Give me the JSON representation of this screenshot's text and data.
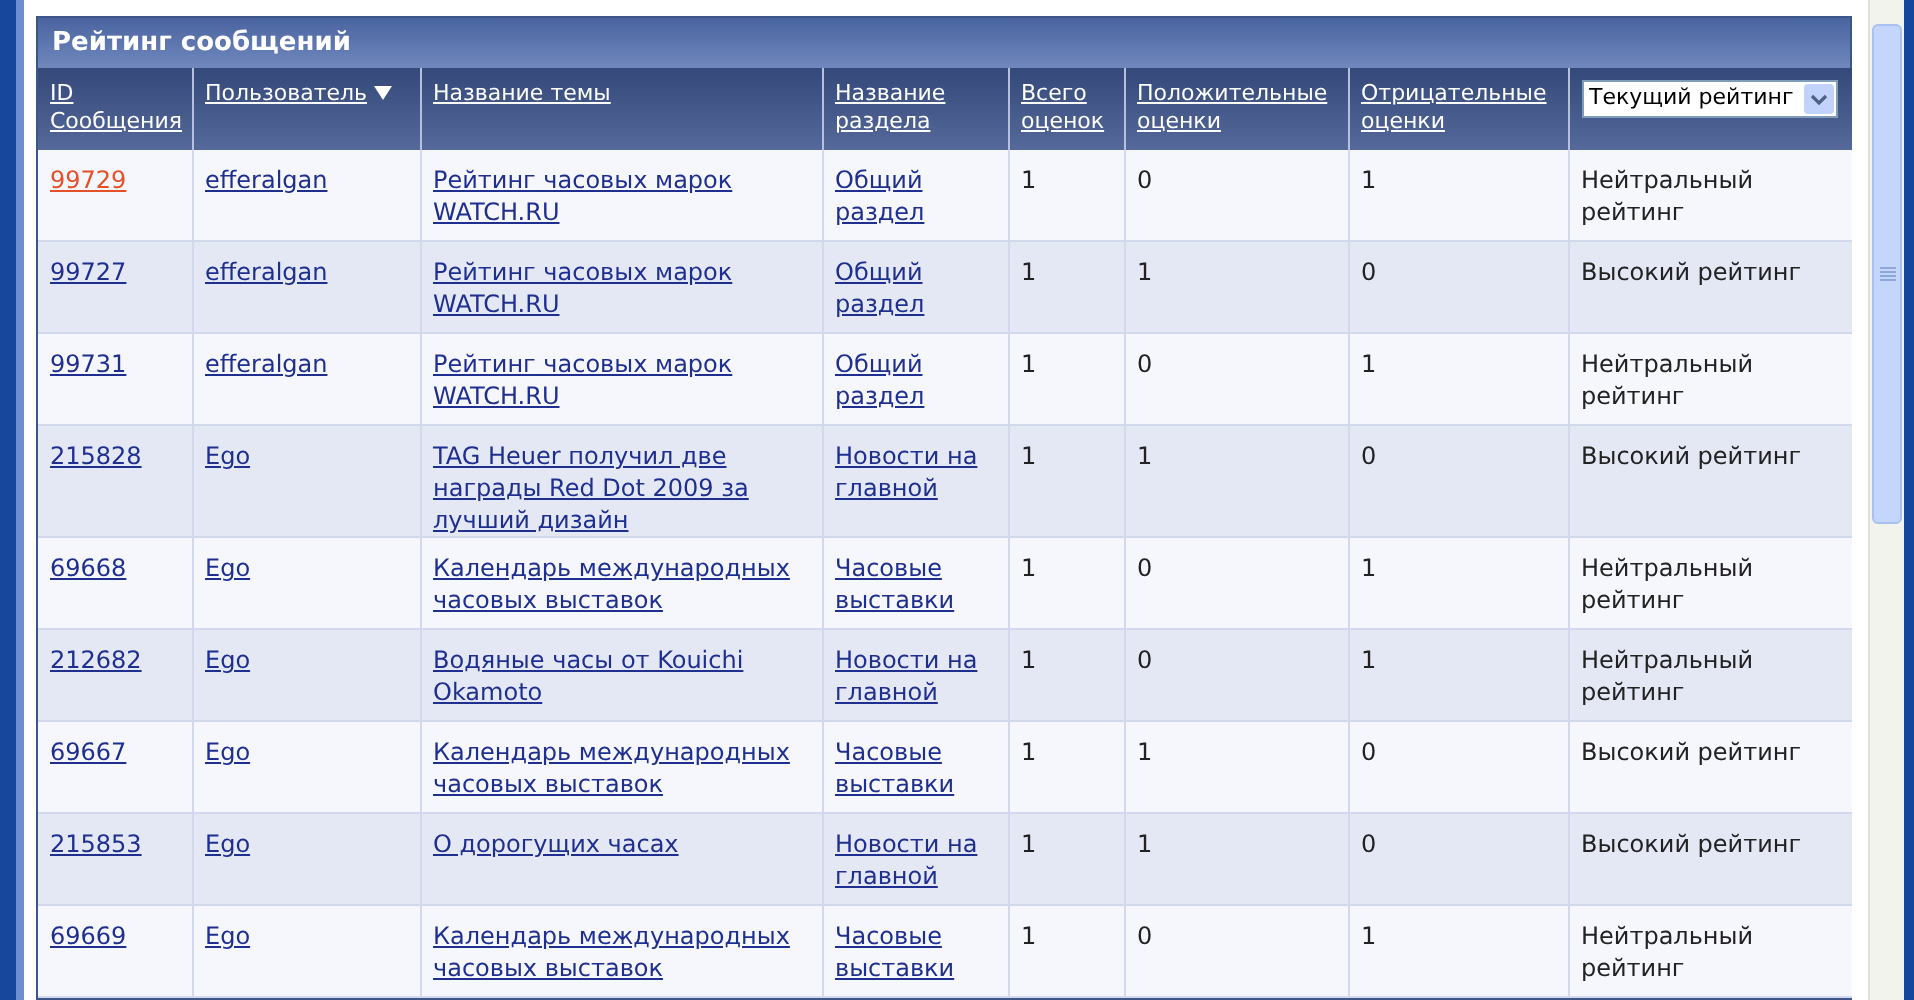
{
  "panel": {
    "title": "Рейтинг сообщений"
  },
  "table": {
    "columns": [
      {
        "label": "ID Сообщения",
        "sorted": false
      },
      {
        "label": "Пользователь",
        "sorted": true
      },
      {
        "label": "Название темы",
        "sorted": false
      },
      {
        "label": "Название раздела",
        "sorted": false
      },
      {
        "label": "Всего оценок",
        "sorted": false
      },
      {
        "label": "Положительные оценки",
        "sorted": false
      },
      {
        "label": "Отрицательные оценки",
        "sorted": false
      }
    ],
    "filter": {
      "value": "Текущий рейтинг"
    },
    "rows": [
      {
        "id": "99729",
        "highlighted": true,
        "user": "efferalgan",
        "topic": "Рейтинг часовых марок WATCH.RU",
        "section": "Общий раздел",
        "total": "1",
        "positive": "0",
        "negative": "1",
        "rating": "Нейтральный рейтинг"
      },
      {
        "id": "99727",
        "highlighted": false,
        "user": "efferalgan",
        "topic": "Рейтинг часовых марок WATCH.RU",
        "section": "Общий раздел",
        "total": "1",
        "positive": "1",
        "negative": "0",
        "rating": "Высокий рейтинг"
      },
      {
        "id": "99731",
        "highlighted": false,
        "user": "efferalgan",
        "topic": "Рейтинг часовых марок WATCH.RU",
        "section": "Общий раздел",
        "total": "1",
        "positive": "0",
        "negative": "1",
        "rating": "Нейтральный рейтинг"
      },
      {
        "id": "215828",
        "highlighted": false,
        "user": "Ego",
        "topic": "TAG Heuer получил две награды Red Dot 2009 за лучший дизайн",
        "section": "Новости на главной",
        "total": "1",
        "positive": "1",
        "negative": "0",
        "rating": "Высокий рейтинг"
      },
      {
        "id": "69668",
        "highlighted": false,
        "user": "Ego",
        "topic": "Календарь международных часовых выставок",
        "section": "Часовые выставки",
        "total": "1",
        "positive": "0",
        "negative": "1",
        "rating": "Нейтральный рейтинг"
      },
      {
        "id": "212682",
        "highlighted": false,
        "user": "Ego",
        "topic": "Водяные часы от Kouichi Okamoto",
        "section": "Новости на главной",
        "total": "1",
        "positive": "0",
        "negative": "1",
        "rating": "Нейтральный рейтинг"
      },
      {
        "id": "69667",
        "highlighted": false,
        "user": "Ego",
        "topic": "Календарь международных часовых выставок",
        "section": "Часовые выставки",
        "total": "1",
        "positive": "1",
        "negative": "0",
        "rating": "Высокий рейтинг"
      },
      {
        "id": "215853",
        "highlighted": false,
        "user": "Ego",
        "topic": "О дорогущих часах",
        "section": "Новости на главной",
        "total": "1",
        "positive": "1",
        "negative": "0",
        "rating": "Высокий рейтинг"
      },
      {
        "id": "69669",
        "highlighted": false,
        "user": "Ego",
        "topic": "Календарь международных часовых выставок",
        "section": "Часовые выставки",
        "total": "1",
        "positive": "0",
        "negative": "1",
        "rating": "Нейтральный рейтинг"
      }
    ]
  }
}
